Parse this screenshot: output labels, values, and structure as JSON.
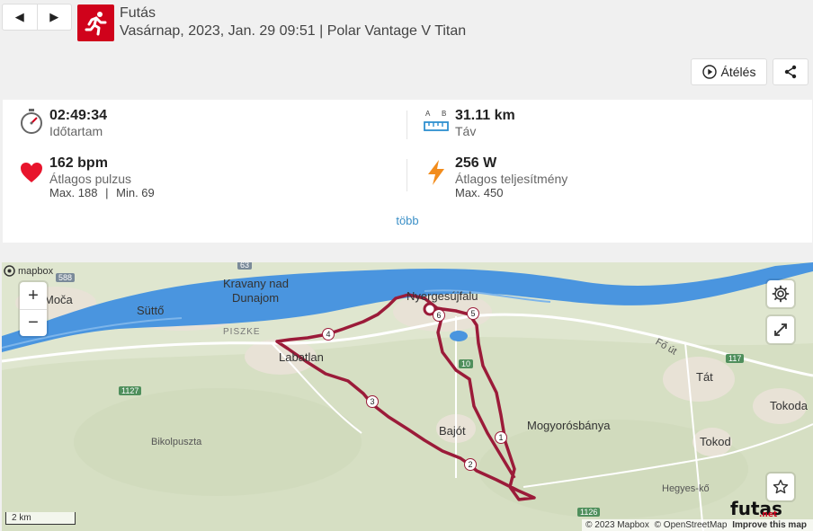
{
  "header": {
    "prev_label": "◀",
    "next_label": "▶",
    "title": "Futás",
    "subtitle": "Vasárnap, 2023, Jan. 29 09:51 | Polar Vantage V Titan",
    "replay_label": "Átélés",
    "sport_icon": "running-person-icon"
  },
  "stats": {
    "duration": {
      "value": "02:49:34",
      "label": "Időtartam",
      "icon": "stopwatch-icon"
    },
    "distance": {
      "value": "31.11 km",
      "label": "Táv",
      "icon": "ruler-icon",
      "ab_a": "A",
      "ab_b": "B"
    },
    "heart": {
      "value": "162 bpm",
      "label": "Átlagos pulzus",
      "max": "Max. 188",
      "sep": "|",
      "min": "Min. 69",
      "icon": "heart-icon",
      "color": "#e8142c"
    },
    "power": {
      "value": "256 W",
      "label": "Átlagos teljesítmény",
      "max": "Max. 450",
      "icon": "lightning-icon",
      "color": "#f28c1c"
    },
    "more_label": "több"
  },
  "map": {
    "places": {
      "moca": "Moča",
      "sutto": "Süttő",
      "kravany1": "Kravany nad",
      "kravany2": "Dunajom",
      "nyergesujfalu": "Nyergesújfalu",
      "piszke": "PISZKE",
      "labatlan": "Labatlan",
      "bajot": "Bajót",
      "mogyorosbanya": "Mogyorósbánya",
      "tat": "Tát",
      "tokoda": "Tokoda",
      "tokod": "Tokod",
      "bikolpuszta": "Bikolpuszta",
      "hegyesko": "Hegyes-kő",
      "foot": "Fő út"
    },
    "roads": {
      "r588": "588",
      "r63": "63",
      "r117": "117",
      "r1127": "1127",
      "r1126": "1126",
      "r10": "10"
    },
    "km_markers": [
      "1",
      "2",
      "3",
      "4",
      "5",
      "6"
    ],
    "zoom_in": "+",
    "zoom_out": "−",
    "logo": "mapbox",
    "scale": "2 km",
    "attribution": {
      "c1": "© 2023 Mapbox",
      "c2": "© OpenStreetMap",
      "c3": "Improve this map"
    },
    "watermark": "futas",
    "watermark_sub": ".net",
    "route_color": "#9b1b39",
    "river_color": "#3a8fd9"
  }
}
